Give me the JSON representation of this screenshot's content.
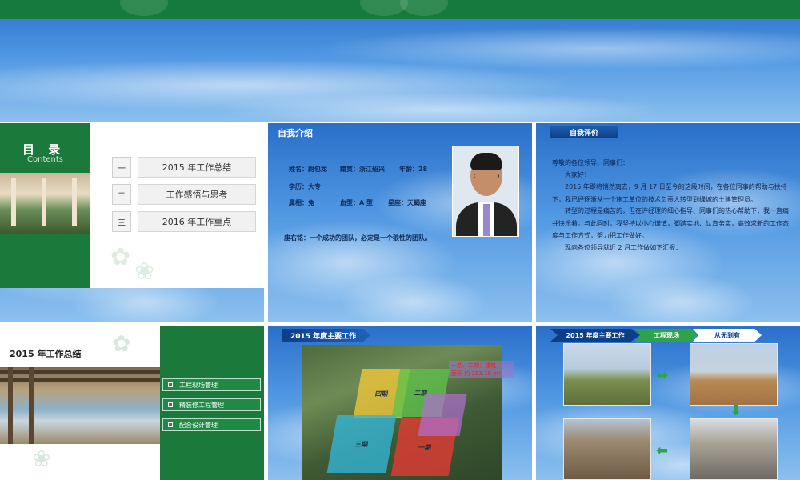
{
  "slide1": {
    "title": "目 录",
    "subtitle": "Contents",
    "items": [
      {
        "num": "一",
        "label": "2015 年工作总结"
      },
      {
        "num": "二",
        "label": "工作感悟与思考"
      },
      {
        "num": "三",
        "label": "2016 年工作重点"
      }
    ]
  },
  "slide2": {
    "title": "自我介绍",
    "name_label": "姓名：尉包龙",
    "origin_label": "籍贯：浙江绍兴",
    "age_label": "年龄：28",
    "edu_label": "学历：大专",
    "zodiac_label": "属相：兔",
    "blood_label": "血型：A 型",
    "star_label": "星座：天蝎座",
    "motto": "座右铭：一个成功的团队，必定是一个狼性的团队。"
  },
  "slide3": {
    "badge": "自我评价",
    "greeting": "尊敬的各位领导、同事们：",
    "hello": "大家好！",
    "para1": "2015 年即将悄然离去，9 月 17 日至今的这段时间，在各位同事的帮助与扶持下，我已经逐渐从一个施工单位的技术负责人转型到绿城的土建管理员。",
    "para2": "转型的过程是痛苦的，但在许经理的细心指导、同事们的热心帮助下，我一直痛并快乐着。与此同时，我坚持以小心谨慎，脚踏实地、认真务实，高效求新的工作态度与工作方式，努力把工作做好。",
    "para3": "现向各位领导就近 2 月工作做如下汇报："
  },
  "slide4": {
    "title": "2015 年工作总结",
    "menu": [
      "工程现场管理",
      "精装修工程管理",
      "配合设计管理"
    ]
  },
  "slide5": {
    "ribbon": "2015 年度主要工作",
    "zones": [
      "四期",
      "二期",
      "三期",
      "一期"
    ],
    "callout_line1": "一期、二期：建筑",
    "callout_line2": "面积 约 253.19 m²"
  },
  "slide6": {
    "steps": [
      "2015 年度主要工作",
      "工程现场",
      "从无到有"
    ]
  },
  "colors": {
    "green": "#1b7a3b",
    "navy": "#0d3f87",
    "accent_green": "#2ea34a"
  }
}
